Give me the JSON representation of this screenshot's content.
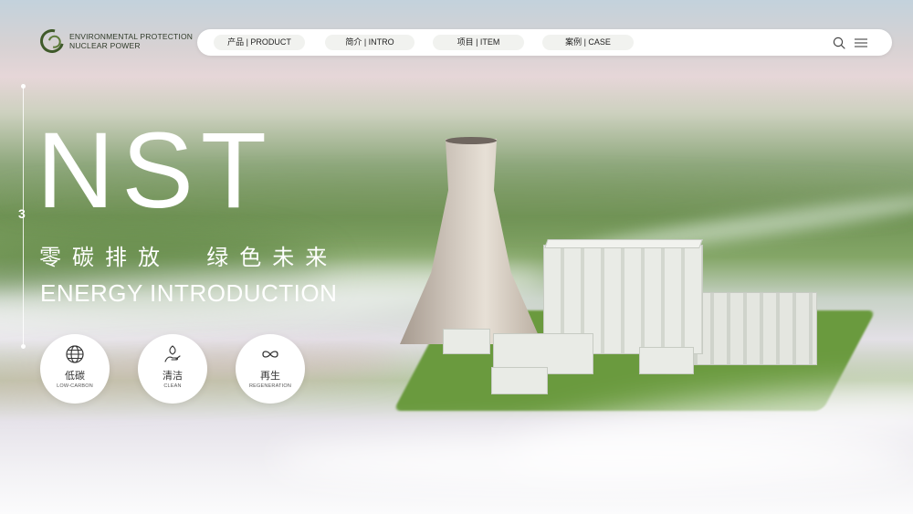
{
  "brand": {
    "line1": "ENVIRONMENTAL PROTECTION",
    "line2": "NUCLEAR POWER",
    "accent_color": "#3f5a2a"
  },
  "nav": {
    "items": [
      {
        "label": "产品 | PRODUCT"
      },
      {
        "label": "简介 | INTRO"
      },
      {
        "label": "项目 | ITEM"
      },
      {
        "label": "案例 | CASE"
      }
    ],
    "search_icon": "search-icon",
    "menu_icon": "hamburger-menu-icon"
  },
  "hero": {
    "slide_number": "3",
    "title": "NST",
    "subtitle": "零碳排放  绿色未来",
    "english_title": "ENERGY INTRODUCTION"
  },
  "features": [
    {
      "icon": "globe-icon",
      "label_zh": "低碳",
      "label_en": "LOW-CARBON"
    },
    {
      "icon": "hand-leaf-icon",
      "label_zh": "清洁",
      "label_en": "CLEAN"
    },
    {
      "icon": "infinity-icon",
      "label_zh": "再生",
      "label_en": "REGENERATION"
    }
  ]
}
